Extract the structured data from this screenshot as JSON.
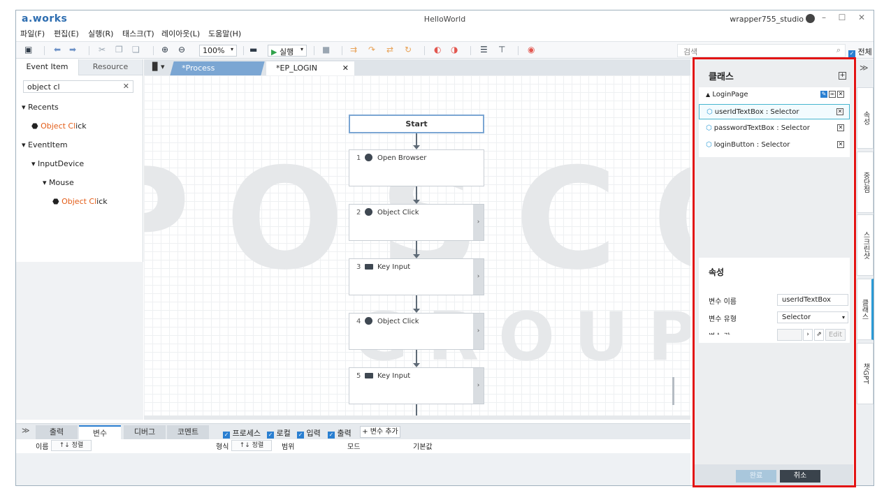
{
  "app": {
    "logo": "a.works",
    "title": "HelloWorld",
    "user": "wrapper755_studio"
  },
  "window_controls": {
    "minimize": "–",
    "maximize": "☐",
    "close": "✕"
  },
  "menu": [
    "파일(F)",
    "편집(E)",
    "실행(R)",
    "태스크(T)",
    "레이아웃(L)",
    "도움말(H)"
  ],
  "toolbar": {
    "zoom": "100%",
    "run_label": "실행",
    "search_placeholder": "검색",
    "all_label": "전체"
  },
  "left_panel": {
    "tabs": [
      "Event Item",
      "Resource"
    ],
    "search_value": "object cl",
    "tree": [
      {
        "label": "Recents",
        "level": 0,
        "arrow": "▾"
      },
      {
        "label_hl": "Object Cl",
        "label_rest": "ick",
        "level": 1
      },
      {
        "label": "EventItem",
        "level": 0,
        "arrow": "▾"
      },
      {
        "label": "InputDevice",
        "level": 1,
        "arrow": "▾"
      },
      {
        "label": "Mouse",
        "level": 2,
        "arrow": "▾"
      },
      {
        "label_hl": "Object Cl",
        "label_rest": "ick",
        "level": 3
      }
    ]
  },
  "editor": {
    "tabs": [
      "*Process",
      "*EP_LOGIN"
    ],
    "watermark_top": "POSCO",
    "watermark_bottom": "GROUP",
    "start_label": "Start",
    "nodes": [
      {
        "num": "1",
        "label": "Open Browser",
        "icon": "browser-icon"
      },
      {
        "num": "2",
        "label": "Object Click",
        "icon": "mouse-icon"
      },
      {
        "num": "3",
        "label": "Key Input",
        "icon": "keyboard-icon"
      },
      {
        "num": "4",
        "label": "Object Click",
        "icon": "mouse-icon"
      },
      {
        "num": "5",
        "label": "Key Input",
        "icon": "keyboard-icon"
      }
    ]
  },
  "bottom": {
    "tabs": [
      "출력",
      "변수",
      "디버그",
      "코멘트"
    ],
    "filters": [
      "프로세스",
      "로컬",
      "입력",
      "출력"
    ],
    "add_var": "+ 변수 추가",
    "headers": {
      "name": "이름",
      "sort": "↑↓ 정렬",
      "type": "형식",
      "scope": "범위",
      "mode": "모드",
      "default": "기본값"
    }
  },
  "right_panel": {
    "class_title": "클래스",
    "page": "LoginPage",
    "items": [
      "userIdTextBox : Selector",
      "passwordTextBox : Selector",
      "loginButton : Selector"
    ],
    "prop_title": "속성",
    "props": [
      {
        "label": "변수 이름",
        "value": "userIdTextBox"
      },
      {
        "label": "변수 유형",
        "value": "Selector"
      },
      {
        "label": "변수 값",
        "value": ""
      }
    ],
    "edit_label": "Edit",
    "ok_label": "완료",
    "cancel_label": "취소"
  },
  "side_tabs": [
    "속성",
    "중단점",
    "스크린샷",
    "클래스",
    "챗GPT"
  ],
  "colors": {
    "accent": "#2a7fd1",
    "highlight": "#e35d18",
    "annotation": "#e31414"
  }
}
